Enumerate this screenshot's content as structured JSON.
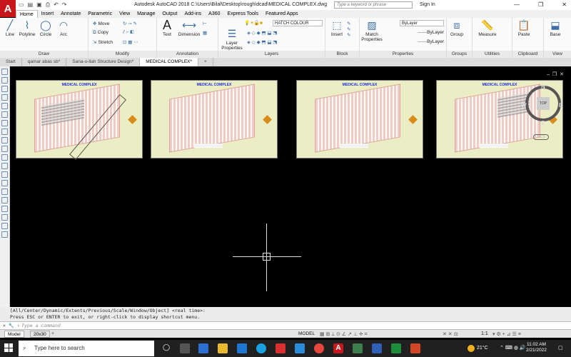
{
  "titlebar": {
    "app_title": "Autodesk AutoCAD 2018   C:\\Users\\Bilal\\Desktop\\rough\\dcad\\MEDICAL COMPLEX.dwg",
    "search_placeholder": "Type a keyword or phrase",
    "sign_in": "Sign In",
    "logo": "A"
  },
  "menu": [
    "Home",
    "Insert",
    "Annotate",
    "Parametric",
    "View",
    "Manage",
    "Output",
    "Add-ins",
    "A360",
    "Express Tools",
    "Featured Apps"
  ],
  "ribbon": {
    "draw": {
      "title": "Draw",
      "line": "Line",
      "polyline": "Polyline",
      "circle": "Circle",
      "arc": "Arc"
    },
    "modify": {
      "title": "Modify",
      "move": "Move",
      "copy": "Copy",
      "stretch": "Stretch"
    },
    "annotation": {
      "title": "Annotation",
      "text": "Text",
      "dimension": "Dimension"
    },
    "layers": {
      "title": "Layers",
      "layer_properties": "Layer Properties",
      "current_layer": "HATCH COLOUR"
    },
    "block": {
      "title": "Block",
      "insert": "Insert"
    },
    "properties": {
      "title": "Properties",
      "match": "Match Properties",
      "bylayer1": "ByLayer",
      "bylayer2": "ByLayer",
      "bylayer3": "ByLayer"
    },
    "groups": {
      "title": "Groups",
      "group": "Group"
    },
    "utilities": {
      "title": "Utilities",
      "measure": "Measure"
    },
    "clipboard": {
      "title": "Clipboard",
      "paste": "Paste"
    },
    "view": {
      "title": "View",
      "base": "Base"
    }
  },
  "tabs": [
    "Start",
    "qamar abas sb*",
    "Sana-u-llah Structure Design*",
    "MEDICAL COMPLEX*"
  ],
  "sheets": [
    {
      "title": "MEDICAL COMPLEX"
    },
    {
      "title": "MEDICAL COMPLEX"
    },
    {
      "title": "MEDICAL COMPLEX"
    },
    {
      "title": "MEDICAL COMPLEX"
    }
  ],
  "viewcube": {
    "n": "N",
    "s": "S",
    "e": "E",
    "w": "W",
    "face": "TOP",
    "wcs": "WCS"
  },
  "command": {
    "history_1": "[All/Center/Dynamic/Extents/Previous/Scale/Window/Object] <real time>:",
    "history_2": "Press ESC or ENTER to exit, or right-click to display shortcut menu.",
    "prompt": "Type a command"
  },
  "status": {
    "model_tab": "Model",
    "layout_tab": "20x30",
    "model": "MODEL",
    "scale": "1:1"
  },
  "taskbar": {
    "search": "Type here to search",
    "temp": "21°C",
    "time": "11:02 AM",
    "date": "2/21/2022"
  },
  "colors": {
    "autocad_red": "#c8161d",
    "sheet_bg": "#ebedc4",
    "title_blue": "#1f2fd1"
  }
}
